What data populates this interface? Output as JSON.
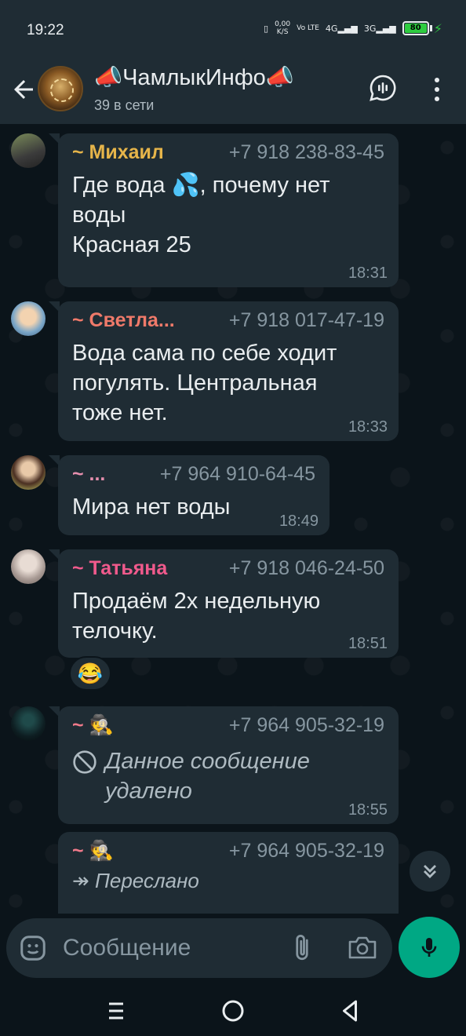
{
  "status_bar": {
    "time": "19:22",
    "net_speed": "0,00",
    "net_speed_unit": "K/S",
    "volte": "Vo LTE",
    "signal1": "4G",
    "signal2": "3G",
    "battery": "80"
  },
  "header": {
    "title": "📣ЧамлыкИнфо📣",
    "subtitle": "39 в сети"
  },
  "messages": [
    {
      "sender": "~ Михаил",
      "sender_color": "#e6b54a",
      "phone": "+7 918 238-83-45",
      "text_lines": [
        "Где вода 💦, почему нет",
        "воды",
        "Красная 25"
      ],
      "time": "18:31"
    },
    {
      "sender": "~ Светла...",
      "sender_color": "#f07a6a",
      "phone": "+7 918 017-47-19",
      "text_lines": [
        "Вода сама по себе ходит",
        "погулять. Центральная",
        "тоже нет."
      ],
      "time": "18:33"
    },
    {
      "sender": "~ ...",
      "sender_color": "#e68fae",
      "phone": "+7 964 910-64-45",
      "text_lines": [
        "Мира нет воды"
      ],
      "time": "18:49"
    },
    {
      "sender": "~ Татьяна",
      "sender_color": "#f05a8c",
      "phone": "+7 918 046-24-50",
      "text_lines": [
        "Продаём 2х недельную",
        "телочку."
      ],
      "time": "18:51",
      "reaction": "😂"
    },
    {
      "sender": "~ 🕵",
      "sender_color": "#f07a8a",
      "phone": "+7 964 905-32-19",
      "deleted": "Данное сообщение удалено",
      "deleted_lines": [
        "Данное сообщение",
        "удалено"
      ],
      "time": "18:55"
    },
    {
      "sender": "~ 🕵",
      "sender_color": "#f07a8a",
      "phone": "+7 964 905-32-19",
      "forwarded_label": "Переслано"
    }
  ],
  "composer": {
    "placeholder": "Сообщение"
  },
  "icons": {
    "back": "arrow-left-icon",
    "voice_chat": "voice-chat-icon",
    "menu": "more-vertical-icon",
    "emoji": "emoji-icon",
    "attach": "paperclip-icon",
    "camera": "camera-icon",
    "mic": "microphone-icon",
    "scroll": "chevron-double-down-icon"
  },
  "colors": {
    "accent": "#00a884",
    "bubble": "#1f2c34",
    "background": "#0b141a"
  }
}
